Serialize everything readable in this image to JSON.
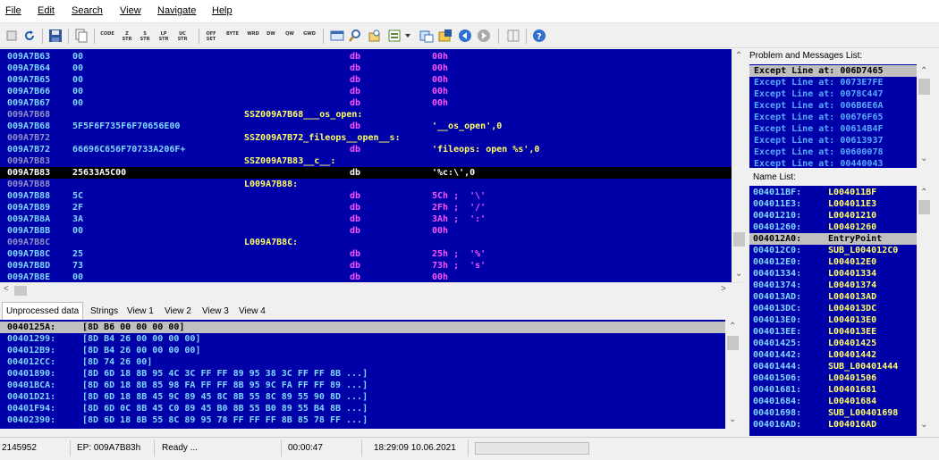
{
  "menu": [
    "File",
    "Edit",
    "Search",
    "View",
    "Navigate",
    "Help"
  ],
  "toolbar": {
    "text_buttons": [
      "CODE",
      "Z STR",
      "S STR",
      "LP STR",
      "UC STR",
      "OFF SET",
      "BYTE",
      "WRD",
      "DW",
      "QW",
      "GWD"
    ],
    "icons": [
      "new-icon",
      "refresh-icon",
      "save-icon",
      "copy-icon",
      "find-panel-icon",
      "search-icon",
      "replace-icon",
      "export-icon",
      "dropdown-icon",
      "image-icon",
      "save-as-icon",
      "back-icon",
      "forward-icon",
      "window-icon",
      "help-icon"
    ]
  },
  "disasm": [
    {
      "addr": "009A7B63",
      "bytes": "00",
      "label": "",
      "op": "db",
      "arg": "00h",
      "argm": true
    },
    {
      "addr": "009A7B64",
      "bytes": "00",
      "label": "",
      "op": "db",
      "arg": "00h",
      "argm": true
    },
    {
      "addr": "009A7B65",
      "bytes": "00",
      "label": "",
      "op": "db",
      "arg": "00h",
      "argm": true
    },
    {
      "addr": "009A7B66",
      "bytes": "00",
      "label": "",
      "op": "db",
      "arg": "00h",
      "argm": true
    },
    {
      "addr": "009A7B67",
      "bytes": "00",
      "label": "",
      "op": "db",
      "arg": "00h",
      "argm": true
    },
    {
      "addr": "009A7B68",
      "bytes": "",
      "label": "SSZ009A7B68___os_open:",
      "op": "",
      "arg": "",
      "dim": true
    },
    {
      "addr": "009A7B68",
      "bytes": "5F5F6F735F6F70656E00",
      "label": "",
      "op": "db",
      "arg": "'__os_open',0"
    },
    {
      "addr": "009A7B72",
      "bytes": "",
      "label": "SSZ009A7B72_fileops__open__s:",
      "op": "",
      "arg": "",
      "dim": true
    },
    {
      "addr": "009A7B72",
      "bytes": "66696C656F70733A206F+",
      "label": "",
      "op": "db",
      "arg": "'fileops: open %s',0"
    },
    {
      "addr": "009A7B83",
      "bytes": "",
      "label": "SSZ009A7B83__c__:",
      "op": "",
      "arg": "",
      "dim": true
    },
    {
      "addr": "009A7B83",
      "bytes": "25633A5C00",
      "label": "",
      "op": "db",
      "arg": "'%c:\\',0",
      "sel": true
    },
    {
      "addr": "009A7B88",
      "bytes": "",
      "label": "L009A7B88:",
      "op": "",
      "arg": "",
      "dim": true
    },
    {
      "addr": "009A7B88",
      "bytes": "5C",
      "label": "",
      "op": "db",
      "arg": "5Ch ;  '\\'",
      "argm": true
    },
    {
      "addr": "009A7B89",
      "bytes": "2F",
      "label": "",
      "op": "db",
      "arg": "2Fh ;  '/'",
      "argm": true
    },
    {
      "addr": "009A7B8A",
      "bytes": "3A",
      "label": "",
      "op": "db",
      "arg": "3Ah ;  ':'",
      "argm": true
    },
    {
      "addr": "009A7B8B",
      "bytes": "00",
      "label": "",
      "op": "db",
      "arg": "00h",
      "argm": true
    },
    {
      "addr": "009A7B8C",
      "bytes": "",
      "label": "L009A7B8C:",
      "op": "",
      "arg": "",
      "dim": true
    },
    {
      "addr": "009A7B8C",
      "bytes": "25",
      "label": "",
      "op": "db",
      "arg": "25h ;  '%'",
      "argm": true
    },
    {
      "addr": "009A7B8D",
      "bytes": "73",
      "label": "",
      "op": "db",
      "arg": "73h ;  's'",
      "argm": true
    },
    {
      "addr": "009A7B8E",
      "bytes": "00",
      "label": "",
      "op": "db",
      "arg": "00h",
      "argm": true
    }
  ],
  "problems": {
    "title": "Problem and Messages List:",
    "items": [
      "Except Line at: 006D7465",
      "Except Line at: 0073E7FE",
      "Except Line at: 0078C447",
      "Except Line at: 006B6E6A",
      "Except Line at: 00676F65",
      "Except Line at: 00614B4F",
      "Except Line at: 00613937",
      "Except Line at: 00600078",
      "Except Line at: 00440043"
    ]
  },
  "names": {
    "title": "Name List:",
    "items": [
      {
        "a": "004011BF:",
        "n": "L004011BF"
      },
      {
        "a": "004011E3:",
        "n": "L004011E3"
      },
      {
        "a": "00401210:",
        "n": "L00401210"
      },
      {
        "a": "00401260:",
        "n": "L00401260"
      },
      {
        "a": "004012A0:",
        "n": "EntryPoint",
        "hl": true
      },
      {
        "a": "004012C0:",
        "n": "SUB_L004012C0"
      },
      {
        "a": "004012E0:",
        "n": "L004012E0"
      },
      {
        "a": "00401334:",
        "n": "L00401334"
      },
      {
        "a": "00401374:",
        "n": "L00401374"
      },
      {
        "a": "004013AD:",
        "n": "L004013AD"
      },
      {
        "a": "004013DC:",
        "n": "L004013DC"
      },
      {
        "a": "004013E0:",
        "n": "L004013E0"
      },
      {
        "a": "004013EE:",
        "n": "L004013EE"
      },
      {
        "a": "00401425:",
        "n": "L00401425"
      },
      {
        "a": "00401442:",
        "n": "L00401442"
      },
      {
        "a": "00401444:",
        "n": "SUB_L00401444"
      },
      {
        "a": "00401506:",
        "n": "L00401506"
      },
      {
        "a": "00401681:",
        "n": "L00401681"
      },
      {
        "a": "00401684:",
        "n": "L00401684"
      },
      {
        "a": "00401698:",
        "n": "SUB_L00401698"
      },
      {
        "a": "004016AD:",
        "n": "L004016AD"
      }
    ]
  },
  "tabs": [
    "Unprocessed data",
    "Strings",
    "View 1",
    "View 2",
    "View 3",
    "View 4"
  ],
  "dataview": [
    {
      "a": "0040125A:",
      "b": "[8D B6 00 00 00 00]",
      "hl": true
    },
    {
      "a": "00401299:",
      "b": "[8D B4 26 00 00 00 00]"
    },
    {
      "a": "004012B9:",
      "b": "[8D B4 26 00 00 00 00]"
    },
    {
      "a": "004012CC:",
      "b": "[8D 74 26 00]"
    },
    {
      "a": "00401890:",
      "b": "[8D 6D 18 8B 95 4C 3C FF FF 89 95 38 3C FF FF 8B ...]"
    },
    {
      "a": "00401BCA:",
      "b": "[8D 6D 18 8B 85 98 FA FF FF 8B 95 9C FA FF FF 89 ...]"
    },
    {
      "a": "00401D21:",
      "b": "[8D 6D 18 8B 45 9C 89 45 8C 8B 55 8C 89 55 90 8D ...]"
    },
    {
      "a": "00401F94:",
      "b": "[8D 6D 0C 8B 45 C0 89 45 B0 8B 55 B0 89 55 B4 8B ...]"
    },
    {
      "a": "00402390:",
      "b": "[8D 6D 18 8B 55 8C 89 95 78 FF FF FF 8B 85 78 FF ...]"
    }
  ],
  "status": {
    "count": "2145952",
    "ep": "EP: 009A7B83h",
    "state": "Ready ...",
    "elapsed": "00:00:47",
    "datetime": "18:29:09 10.06.2021"
  }
}
